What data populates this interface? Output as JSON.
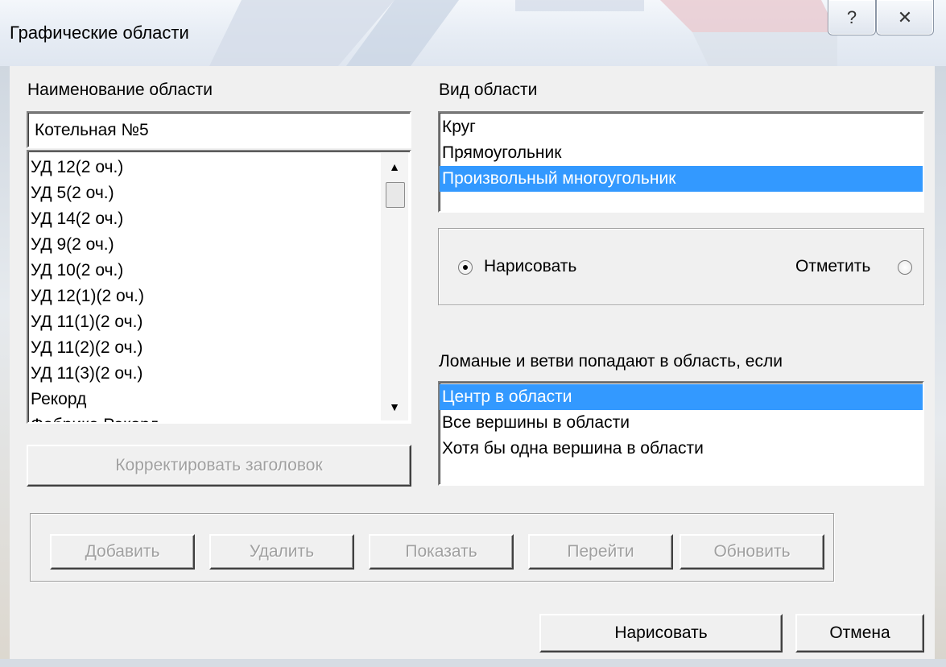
{
  "window": {
    "title": "Графические области",
    "help_glyph": "?",
    "close_glyph": "✕"
  },
  "names": {
    "label": "Наименование области",
    "current_value": "Котельная №5",
    "items": [
      "УД 12(2 оч.)",
      "УД 5(2 оч.)",
      "УД 14(2 оч.)",
      "УД 9(2 оч.)",
      "УД 10(2 оч.)",
      "УД 12(1)(2 оч.)",
      "УД 11(1)(2 оч.)",
      "УД 11(2)(2 оч.)",
      "УД 11(3)(2 оч.)",
      "Рекорд",
      "Фабрика Рекорд"
    ],
    "edit_title_button": "Корректировать заголовок"
  },
  "area_type": {
    "label": "Вид области",
    "items": [
      "Круг",
      "Прямоугольник",
      "Произвольный многоугольник"
    ],
    "selected_index": 2
  },
  "mode": {
    "draw_label": "Нарисовать",
    "mark_label": "Отметить",
    "selected": "draw"
  },
  "inclusion": {
    "label": "Ломаные и ветви попадают в область, если",
    "items": [
      "Центр в области",
      "Все вершины в области",
      "Хотя бы одна вершина в области"
    ],
    "selected_index": 0
  },
  "actions": {
    "add": "Добавить",
    "delete": "Удалить",
    "show": "Показать",
    "goto": "Перейти",
    "refresh": "Обновить"
  },
  "footer": {
    "draw_button": "Нарисовать",
    "cancel_button": "Отмена"
  },
  "colors": {
    "selection": "#3399ff",
    "disabled_text": "#a0a0a0"
  }
}
